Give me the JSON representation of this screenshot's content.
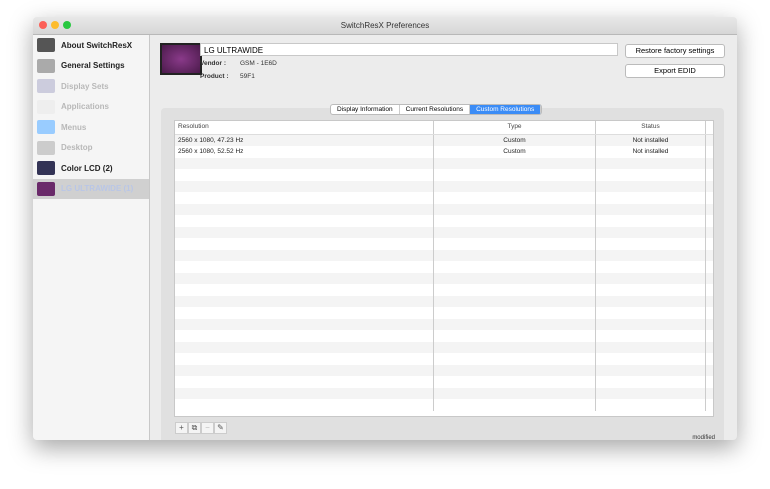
{
  "window": {
    "title": "SwitchResX Preferences"
  },
  "sidebar": {
    "items": [
      {
        "label": "About SwitchResX",
        "state": "normal",
        "icon": "switchresx-icon"
      },
      {
        "label": "General Settings",
        "state": "normal",
        "icon": "switch-icon"
      },
      {
        "label": "Display Sets",
        "state": "disabled",
        "icon": "display-sets-icon"
      },
      {
        "label": "Applications",
        "state": "disabled",
        "icon": "applications-icon"
      },
      {
        "label": "Menus",
        "state": "disabled",
        "icon": "menus-icon"
      },
      {
        "label": "Desktop",
        "state": "disabled",
        "icon": "desktop-icon"
      },
      {
        "label": "Color LCD (2)",
        "state": "normal",
        "icon": "laptop-icon"
      },
      {
        "label": "LG ULTRAWIDE (1)",
        "state": "selected",
        "icon": "monitor-icon"
      }
    ]
  },
  "display": {
    "name": "LG ULTRAWIDE",
    "vendor_label": "Vendor :",
    "vendor": "GSM - 1E6D",
    "product_label": "Product :",
    "product": "59F1"
  },
  "buttons": {
    "restore": "Restore factory settings",
    "export": "Export EDID"
  },
  "tabs": [
    {
      "label": "Display Information",
      "active": false
    },
    {
      "label": "Current Resolutions",
      "active": false
    },
    {
      "label": "Custom Resolutions",
      "active": true
    }
  ],
  "table": {
    "headers": [
      "Resolution",
      "Type",
      "Status"
    ],
    "rows": [
      [
        "2560 x 1080, 47.23 Hz",
        "Custom",
        "Not installed"
      ],
      [
        "2560 x 1080, 52.52 Hz",
        "Custom",
        "Not installed"
      ]
    ]
  },
  "toolbar": {
    "add": "+",
    "duplicate": "⧉",
    "remove": "−",
    "edit": "✎"
  },
  "status": "modified",
  "colors": {
    "accent": "#3b8cf6"
  }
}
